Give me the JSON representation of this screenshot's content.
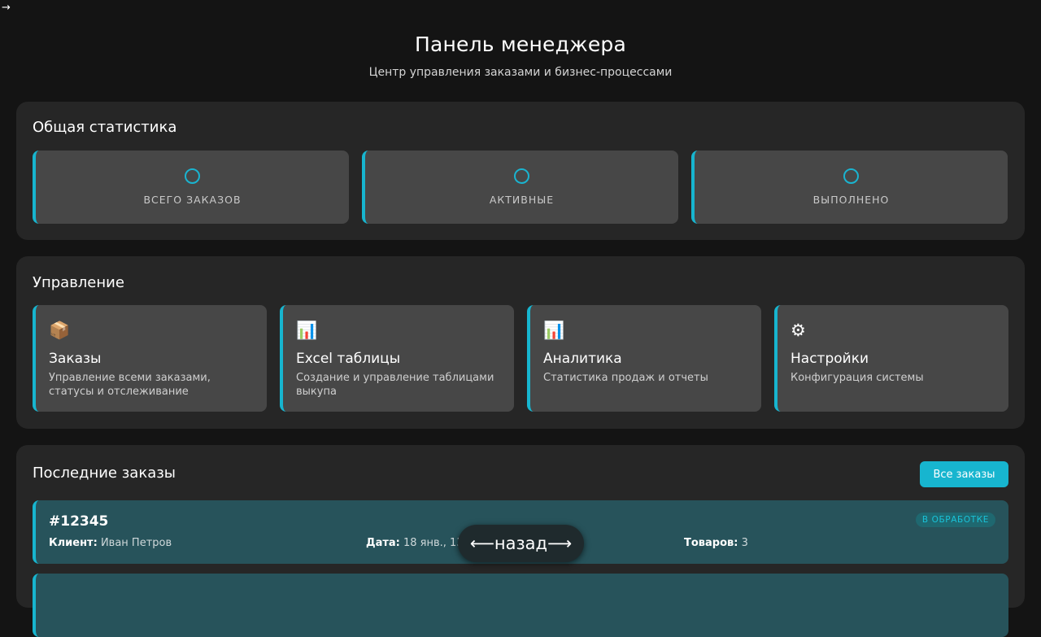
{
  "corner_arrow": "→",
  "header": {
    "title": "Панель менеджера",
    "subtitle": "Центр управления заказами и бизнес-процессами"
  },
  "stats": {
    "heading": "Общая статистика",
    "cards": [
      {
        "label": "Всего заказов"
      },
      {
        "label": "Активные"
      },
      {
        "label": "Выполнено"
      }
    ]
  },
  "management": {
    "heading": "Управление",
    "cards": [
      {
        "icon": "📦",
        "icon_name": "package-icon",
        "title": "Заказы",
        "desc": "Управление всеми заказами, статусы и отслеживание"
      },
      {
        "icon": "📊",
        "icon_name": "bar-chart-icon",
        "title": "Excel таблицы",
        "desc": "Создание и управление таблицами выкупа"
      },
      {
        "icon": "📊",
        "icon_name": "bar-chart-icon",
        "title": "Аналитика",
        "desc": "Статистика продаж и отчеты"
      },
      {
        "icon": "⚙",
        "icon_name": "gear-icon",
        "title": "Настройки",
        "desc": "Конфигурация системы"
      }
    ]
  },
  "orders": {
    "heading": "Последние заказы",
    "all_button": "Все заказы",
    "items": [
      {
        "id": "#12345",
        "status": "В обработке",
        "client_label": "Клиент:",
        "client": "Иван Петров",
        "date_label": "Дата:",
        "date": "18 янв., 13:30",
        "items_label": "Товаров:",
        "items": "3"
      }
    ]
  },
  "back_button": "⟵назад⟶",
  "colors": {
    "accent": "#17b5cf",
    "background": "#141414",
    "panel": "#262626",
    "card": "#474747",
    "order_row": "#27535b"
  }
}
